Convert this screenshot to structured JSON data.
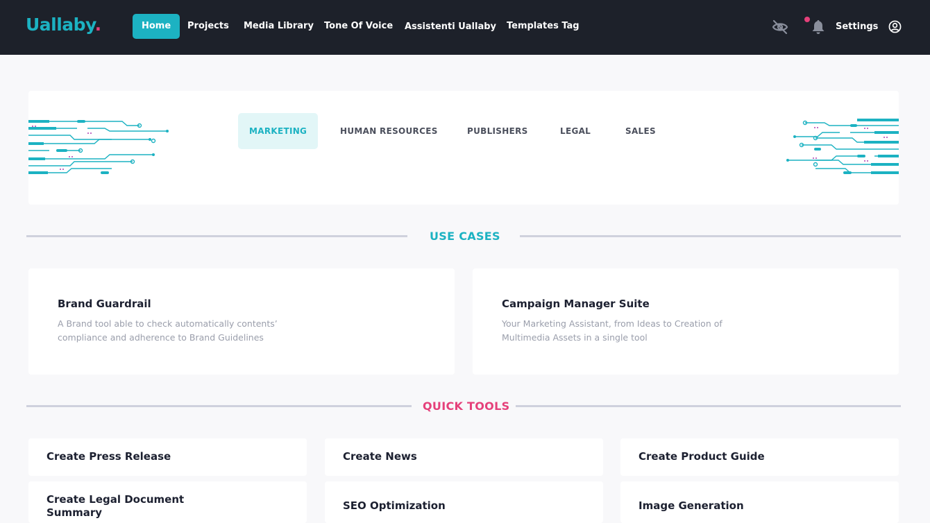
{
  "app": {
    "logo_text": "Uallaby",
    "logo_dot": ".",
    "brand_color": "#1cb2c2",
    "accent_color": "#e5407a"
  },
  "nav": {
    "items": [
      {
        "label": "Home",
        "active": true
      },
      {
        "label": "Projects"
      },
      {
        "label": "Media Library"
      },
      {
        "label": "Tone Of Voice"
      },
      {
        "label": "Assistenti Uallaby"
      },
      {
        "label": "Templates Tag"
      }
    ],
    "settings_label": "Settings",
    "icons": [
      "eye-off-icon",
      "bell-icon",
      "user-circle-icon"
    ]
  },
  "categories": {
    "tabs": [
      {
        "label": "MARKETING",
        "active": true
      },
      {
        "label": "HUMAN RESOURCES"
      },
      {
        "label": "PUBLISHERS"
      },
      {
        "label": "LEGAL"
      },
      {
        "label": "SALES"
      }
    ]
  },
  "use_cases": {
    "title": "USE CASES",
    "title_color": "#1cb2c2",
    "cards": [
      {
        "title": "Brand Guardrail",
        "desc": "A Brand tool able to check automatically contents’ compliance and adherence to Brand Guidelines"
      },
      {
        "title": "Campaign Manager Suite",
        "desc": "Your Marketing Assistant, from Ideas to Creation of Multimedia Assets in a single tool"
      }
    ]
  },
  "quick_tools": {
    "title": "QUICK TOOLS",
    "title_color": "#e5407a",
    "items": [
      "Create Press Release",
      "Create News",
      "Create Product Guide",
      "Create Legal Document Summary",
      "SEO Optimization",
      "Image Generation"
    ]
  }
}
